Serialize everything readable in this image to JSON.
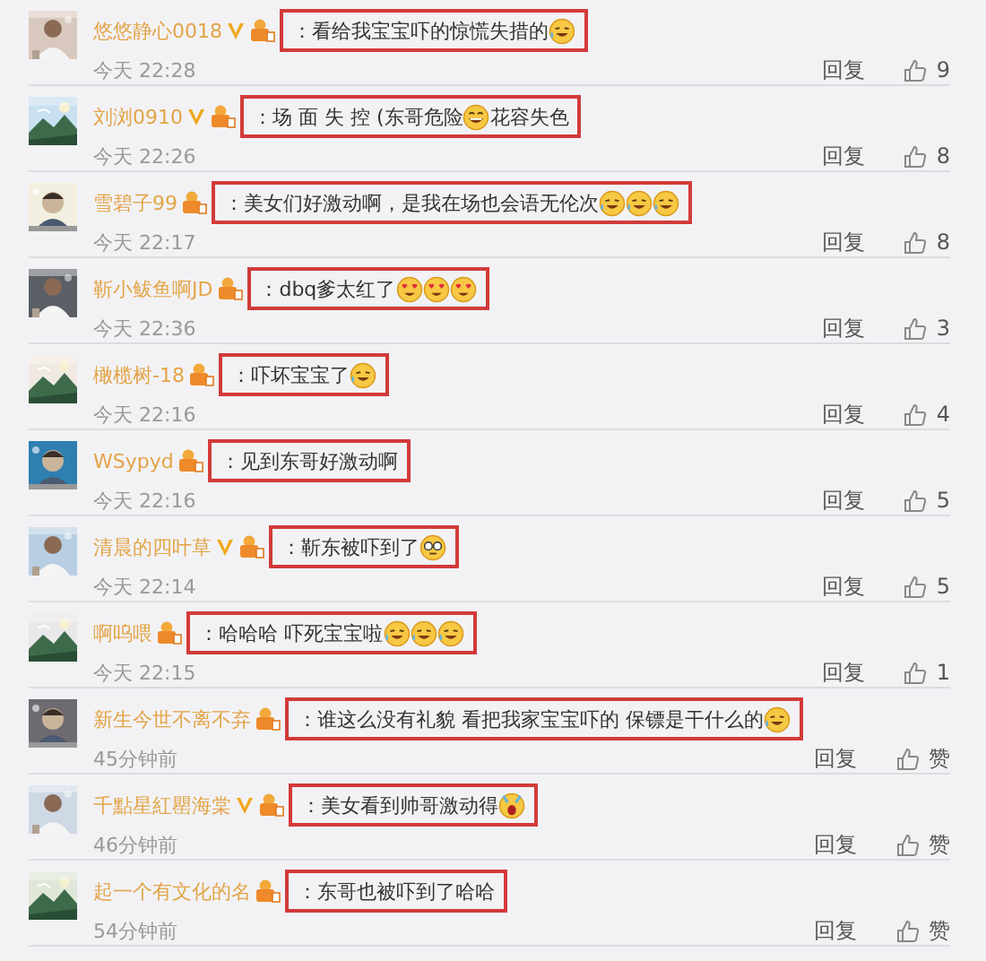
{
  "comments": [
    {
      "name": "悠悠静心0018",
      "verified": true,
      "highlighted": true,
      "content": [
        {
          "kind": "text",
          "text": "：看给我宝宝吓的惊慌失措的"
        },
        {
          "kind": "tears"
        }
      ],
      "time": "今天 22:28",
      "reply": "回复",
      "likes": "9"
    },
    {
      "name": "刘浏0910",
      "verified": true,
      "highlighted": true,
      "content": [
        {
          "kind": "text",
          "text": "：场 面 失 控 (东哥危险"
        },
        {
          "kind": "grin"
        },
        {
          "kind": "text",
          "text": "花容失色"
        }
      ],
      "time": "今天 22:26",
      "reply": "回复",
      "likes": "8"
    },
    {
      "name": "雪碧子99",
      "verified": false,
      "highlighted": true,
      "content": [
        {
          "kind": "text",
          "text": "：美女们好激动啊，是我在场也会语无伦次"
        },
        {
          "kind": "tears"
        },
        {
          "kind": "tears"
        },
        {
          "kind": "tears"
        }
      ],
      "time": "今天 22:17",
      "reply": "回复",
      "likes": "8"
    },
    {
      "name": "靳小鲅鱼啊JD",
      "verified": false,
      "highlighted": true,
      "content": [
        {
          "kind": "text",
          "text": "：dbq爹太红了"
        },
        {
          "kind": "hearts"
        },
        {
          "kind": "hearts"
        },
        {
          "kind": "hearts"
        }
      ],
      "time": "今天 22:36",
      "reply": "回复",
      "likes": "3"
    },
    {
      "name": "橄榄树-18",
      "verified": false,
      "highlighted": true,
      "content": [
        {
          "kind": "text",
          "text": "：吓坏宝宝了"
        },
        {
          "kind": "tears"
        }
      ],
      "time": "今天 22:16",
      "reply": "回复",
      "likes": "4"
    },
    {
      "name": "WSypyd",
      "verified": false,
      "highlighted": true,
      "content": [
        {
          "kind": "text",
          "text": "：见到东哥好激动啊"
        }
      ],
      "time": "今天 22:16",
      "reply": "回复",
      "likes": "5"
    },
    {
      "name": "清晨的四叶草",
      "verified": true,
      "highlighted": true,
      "content": [
        {
          "kind": "text",
          "text": "：靳东被吓到了"
        },
        {
          "kind": "glasses"
        }
      ],
      "time": "今天 22:14",
      "reply": "回复",
      "likes": "5"
    },
    {
      "name": "啊呜喂",
      "verified": false,
      "highlighted": true,
      "content": [
        {
          "kind": "text",
          "text": "：哈哈哈 吓死宝宝啦"
        },
        {
          "kind": "tears"
        },
        {
          "kind": "tears"
        },
        {
          "kind": "tears"
        }
      ],
      "time": "今天 22:15",
      "reply": "回复",
      "likes": "1"
    },
    {
      "name": "新生今世不离不弃",
      "verified": false,
      "highlighted": true,
      "content": [
        {
          "kind": "text",
          "text": "：谁这么没有礼貌 看把我家宝宝吓的  保镖是干什么的"
        },
        {
          "kind": "tears"
        }
      ],
      "time": "45分钟前",
      "reply": "回复",
      "likes": "赞"
    },
    {
      "name": "千點星紅罌海棠",
      "verified": true,
      "highlighted": true,
      "content": [
        {
          "kind": "text",
          "text": "：美女看到帅哥激动得"
        },
        {
          "kind": "scream"
        }
      ],
      "time": "46分钟前",
      "reply": "回复",
      "likes": "赞"
    },
    {
      "name": "起一个有文化的名",
      "verified": false,
      "highlighted": true,
      "content": [
        {
          "kind": "text",
          "text": "：东哥也被吓到了哈哈"
        }
      ],
      "time": "54分钟前",
      "reply": "回复",
      "likes": "赞"
    }
  ]
}
